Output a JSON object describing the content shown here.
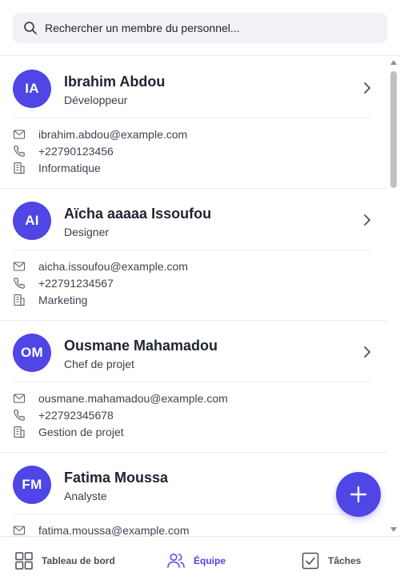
{
  "search": {
    "placeholder": "Rechercher un membre du personnel..."
  },
  "members": [
    {
      "initials": "IA",
      "name": "Ibrahim Abdou",
      "role": "Développeur",
      "email": "ibrahim.abdou@example.com",
      "phone": "+22790123456",
      "department": "Informatique"
    },
    {
      "initials": "AI",
      "name": "Aïcha aaaaa Issoufou",
      "role": "Designer",
      "email": "aicha.issoufou@example.com",
      "phone": "+22791234567",
      "department": "Marketing"
    },
    {
      "initials": "OM",
      "name": "Ousmane Mahamadou",
      "role": "Chef de projet",
      "email": "ousmane.mahamadou@example.com",
      "phone": "+22792345678",
      "department": "Gestion de projet"
    },
    {
      "initials": "FM",
      "name": "Fatima Moussa",
      "role": "Analyste",
      "email": "fatima.moussa@example.com"
    }
  ],
  "nav": {
    "dashboard": "Tableau de bord",
    "team": "Équipe",
    "tasks": "Tâches"
  },
  "icons": {
    "search": "search-icon",
    "email": "mail-icon",
    "phone": "phone-icon",
    "department": "building-icon",
    "open": "chevron-right-icon",
    "add": "plus-icon",
    "dashboard": "grid-icon",
    "team": "users-icon",
    "tasks": "checkbox-icon"
  },
  "colors": {
    "accent": "#4f46e5",
    "text": "#1f2430",
    "muted": "#3f4450"
  }
}
